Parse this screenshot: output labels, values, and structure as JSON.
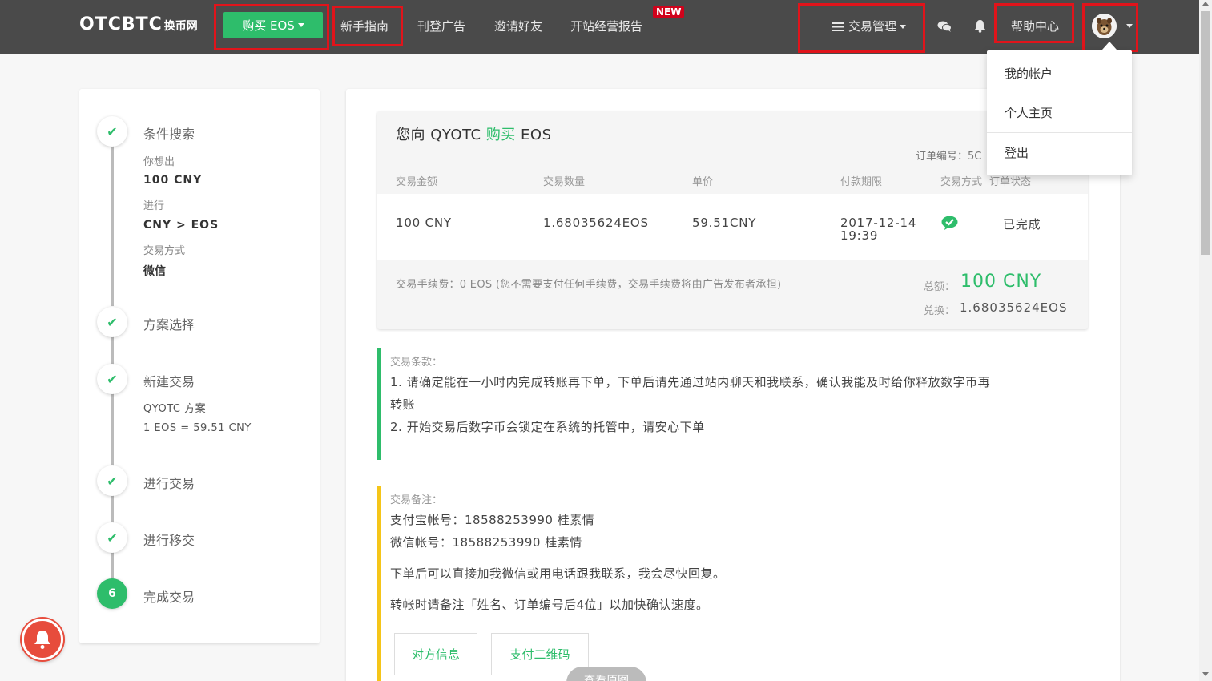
{
  "navbar": {
    "brand": "OTCBTC",
    "brand_sub": "换币网",
    "buy_label": "购买 EOS",
    "guide": "新手指南",
    "post_ad": "刊登广告",
    "invite": "邀请好友",
    "report": "开站经营报告",
    "new_badge": "NEW",
    "trade_manage": "交易管理",
    "help": "帮助中心"
  },
  "dropdown": {
    "account": "我的帐户",
    "profile": "个人主页",
    "logout": "登出"
  },
  "steps": {
    "s1_title": "条件搜索",
    "s1_want_label": "你想出",
    "s1_want_val": "100 CNY",
    "s1_do_label": "进行",
    "s1_do_val": "CNY > EOS",
    "s1_method_label": "交易方式",
    "s1_method_val": "微信",
    "s2_title": "方案选择",
    "s3_title": "新建交易",
    "s3_plan": "QYOTC 方案",
    "s3_rate": "1 EOS = 59.51 CNY",
    "s4_title": "进行交易",
    "s5_title": "进行移交",
    "s6_num": "6",
    "s6_title": "完成交易"
  },
  "order": {
    "title_prefix": "您向 QYOTC ",
    "title_action": "购买",
    "title_suffix": " EOS",
    "order_no": "订单编号：5C",
    "headers": [
      "交易金额",
      "交易数量",
      "单价",
      "付款期限",
      "交易方式",
      "订单状态"
    ],
    "amount": "100 CNY",
    "quantity": "1.68035624EOS",
    "price": "59.51CNY",
    "deadline_date": "2017-12-14",
    "deadline_time": "19:39",
    "status": "已完成",
    "fee": "交易手续费：0 EOS (您不需要支付任何手续费，交易手续费将由广告发布者承担)",
    "total_label": "总额：",
    "total_val": "100 CNY",
    "exch_label": "兑换：",
    "exch_val": "1.68035624EOS"
  },
  "terms": {
    "label": "交易条款：",
    "line1": "1. 请确定能在一小时内完成转账再下单，下单后请先通过站内聊天和我联系，确认我能及时给你释放数字币再",
    "line1b": "转账",
    "line2": "2. 开始交易后数字币会锁定在系统的托管中，请安心下单"
  },
  "notes": {
    "label": "交易备注：",
    "alipay": "支付宝帐号：18588253990 桂素情",
    "wechat": "微信帐号：18588253990 桂素情",
    "line3": "下单后可以直接加我微信或用电话跟我联系，我会尽快回复。",
    "line4": "转帐时请备注「姓名、订单编号后4位」以加快确认速度。"
  },
  "buttons": {
    "counterparty": "对方信息",
    "qr": "支付二维码",
    "view_image": "查看原图"
  },
  "colors": {
    "accent": "#2ebd6b",
    "navbar": "#4a4a4a",
    "highlight": "#e0141b",
    "notes_bar": "#f5c518"
  }
}
